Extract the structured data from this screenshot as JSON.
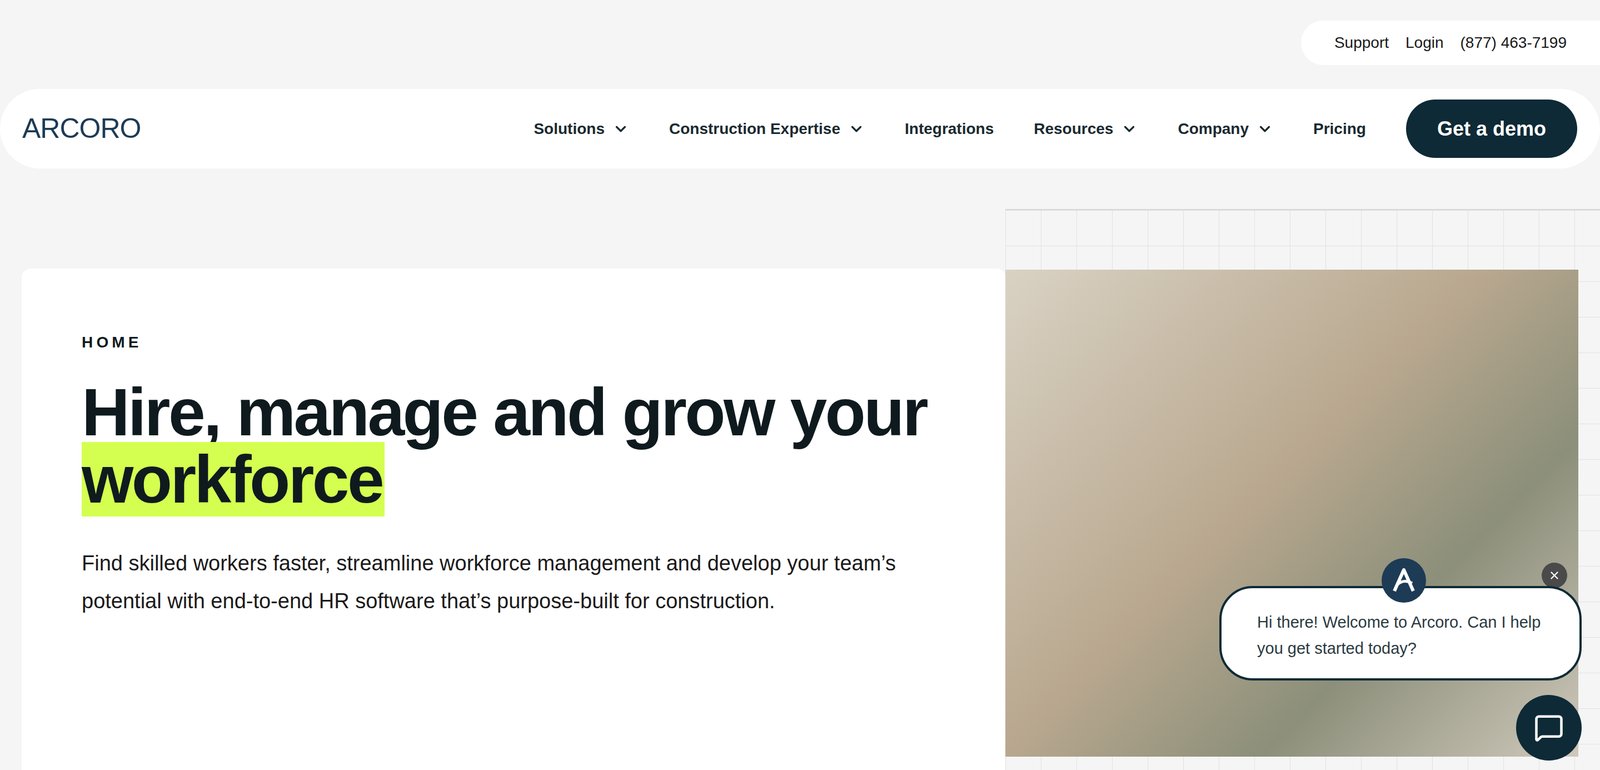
{
  "topbar": {
    "links": [
      "Support",
      "Login",
      "(877) 463-7199"
    ]
  },
  "nav": {
    "logo": "ARCORO",
    "items": [
      {
        "label": "Solutions",
        "has_menu": true
      },
      {
        "label": "Construction Expertise",
        "has_menu": true
      },
      {
        "label": "Integrations",
        "has_menu": false
      },
      {
        "label": "Resources",
        "has_menu": true
      },
      {
        "label": "Company",
        "has_menu": true
      },
      {
        "label": "Pricing",
        "has_menu": false
      }
    ],
    "cta": "Get a demo"
  },
  "hero": {
    "eyebrow": "HOME",
    "headline": "Hire, manage and grow your",
    "highlight": "workforce",
    "body": "Find skilled workers faster, streamline workforce management and develop your team’s potential with end-to-end HR software that’s purpose-built for construction."
  },
  "chat": {
    "message": "Hi there! Welcome to Arcoro. Can I help you get started today?"
  }
}
